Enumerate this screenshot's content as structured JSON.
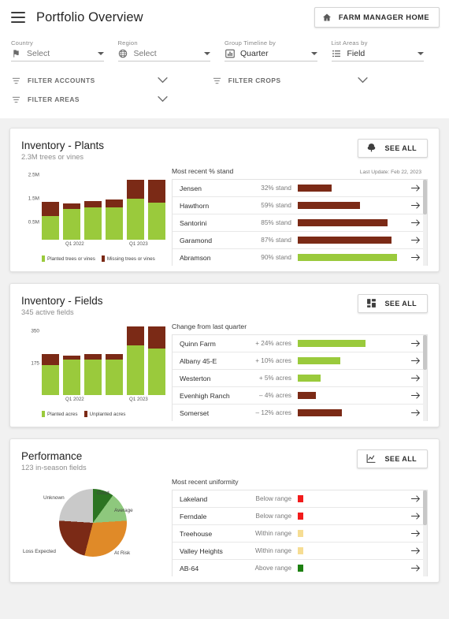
{
  "header": {
    "menu_icon": "hamburger-menu-icon",
    "title": "Portfolio Overview",
    "home_button_label": "FARM MANAGER HOME",
    "home_button_icon": "home-icon"
  },
  "filters": {
    "selects": [
      {
        "label": "Country",
        "value": "Select",
        "icon": "flag-icon",
        "is_placeholder": true
      },
      {
        "label": "Region",
        "value": "Select",
        "icon": "globe-icon",
        "is_placeholder": true
      },
      {
        "label": "Group Timeline by",
        "value": "Quarter",
        "icon": "bar-chart-icon",
        "is_placeholder": false
      },
      {
        "label": "List Areas by",
        "value": "Field",
        "icon": "list-icon",
        "is_placeholder": false
      }
    ],
    "toggles": [
      {
        "label": "FILTER ACCOUNTS",
        "icon": "filter-icon"
      },
      {
        "label": "FILTER CROPS",
        "icon": "filter-icon"
      },
      {
        "label": "FILTER AREAS",
        "icon": "filter-icon"
      }
    ]
  },
  "cards": [
    {
      "title": "Inventory - Plants",
      "subtitle": "2.3M trees or vines",
      "see_all_label": "SEE ALL",
      "see_all_icon": "tree-icon",
      "list_title": "Most recent % stand",
      "last_update": "Last Update: Feb 22, 2023",
      "rows": [
        {
          "name": "Jensen",
          "value": "32% stand",
          "bar_pct": 32,
          "color": "#7b2a16"
        },
        {
          "name": "Hawthorn",
          "value": "59% stand",
          "bar_pct": 59,
          "color": "#7b2a16"
        },
        {
          "name": "Santorini",
          "value": "85% stand",
          "bar_pct": 85,
          "color": "#7b2a16"
        },
        {
          "name": "Garamond",
          "value": "87% stand",
          "bar_pct": 87,
          "color": "#7b2a16"
        },
        {
          "name": "Abramson",
          "value": "90% stand",
          "bar_pct": 90,
          "color": "#9aca3c"
        }
      ]
    },
    {
      "title": "Inventory - Fields",
      "subtitle": "345 active fields",
      "see_all_label": "SEE ALL",
      "see_all_icon": "grid-tiles-icon",
      "list_title": "Change from last quarter",
      "last_update": "",
      "rows": [
        {
          "name": "Quinn Farm",
          "value": "+ 24% acres",
          "bar_pct": 64,
          "color": "#9aca3c"
        },
        {
          "name": "Albany 45-E",
          "value": "+ 10% acres",
          "bar_pct": 40,
          "color": "#9aca3c"
        },
        {
          "name": "Westerton",
          "value": "+ 5% acres",
          "bar_pct": 22,
          "color": "#9aca3c"
        },
        {
          "name": "Evenhigh Ranch",
          "value": "– 4% acres",
          "bar_pct": 17,
          "color": "#7b2a16"
        },
        {
          "name": "Somerset",
          "value": "– 12% acres",
          "bar_pct": 42,
          "color": "#7b2a16"
        }
      ]
    },
    {
      "title": "Performance",
      "subtitle": "123 in-season fields",
      "see_all_label": "SEE ALL",
      "see_all_icon": "line-chart-icon",
      "list_title": "Most recent uniformity",
      "last_update": "",
      "rows": [
        {
          "name": "Lakeland",
          "value": "Below range",
          "bar_pct": 5,
          "color": "#f21b1b"
        },
        {
          "name": "Ferndale",
          "value": "Below range",
          "bar_pct": 5,
          "color": "#f21b1b"
        },
        {
          "name": "Treehouse",
          "value": "Within range",
          "bar_pct": 5,
          "color": "#f6dd93"
        },
        {
          "name": "Valley Heights",
          "value": "Within range",
          "bar_pct": 5,
          "color": "#f6dd93"
        },
        {
          "name": "AB-64",
          "value": "Above range",
          "bar_pct": 5,
          "color": "#1d8011"
        }
      ]
    }
  ],
  "chart_data": [
    {
      "type": "bar",
      "stacked": true,
      "title": "Inventory - Plants",
      "categories": [
        "",
        "Q1 2022",
        "",
        "",
        "Q1 2023",
        ""
      ],
      "xtick_labels": [
        "Q1 2022",
        "Q1 2023"
      ],
      "ylabel": "",
      "ytick_labels": [
        "0.5M",
        "1.5M",
        "2.5M"
      ],
      "ylim": [
        0,
        2900000
      ],
      "series": [
        {
          "name": "Planted trees or vines",
          "color": "#9aca3c",
          "values": [
            1000000,
            1300000,
            1350000,
            1350000,
            1700000,
            1550000
          ]
        },
        {
          "name": "Missing trees or vines",
          "color": "#7b2a16",
          "values": [
            600000,
            200000,
            250000,
            300000,
            800000,
            950000
          ]
        }
      ],
      "grid": false,
      "legend_position": "bottom"
    },
    {
      "type": "bar",
      "stacked": true,
      "title": "Inventory - Fields",
      "categories": [
        "",
        "Q1 2022",
        "",
        "",
        "Q1 2023",
        ""
      ],
      "xtick_labels": [
        "Q1 2022",
        "Q1 2023"
      ],
      "ylabel": "",
      "ytick_labels": [
        "175",
        "350"
      ],
      "ylim": [
        0,
        400
      ],
      "series": [
        {
          "name": "Planted acres",
          "color": "#9aca3c",
          "values": [
            152,
            182,
            180,
            180,
            253,
            238
          ]
        },
        {
          "name": "Unplanted acres",
          "color": "#7b2a16",
          "values": [
            58,
            17,
            28,
            28,
            97,
            112
          ]
        }
      ],
      "grid": false,
      "legend_position": "bottom"
    },
    {
      "type": "pie",
      "title": "Performance",
      "labels": [
        "Good",
        "Average",
        "At Risk",
        "Loss Expected",
        "Unknown"
      ],
      "values": [
        10,
        14,
        30,
        22,
        24
      ],
      "colors": [
        "#2c7422",
        "#8ec87d",
        "#e08a28",
        "#7b2a16",
        "#c9c9c9"
      ],
      "legend_position": "callout-labels"
    }
  ]
}
